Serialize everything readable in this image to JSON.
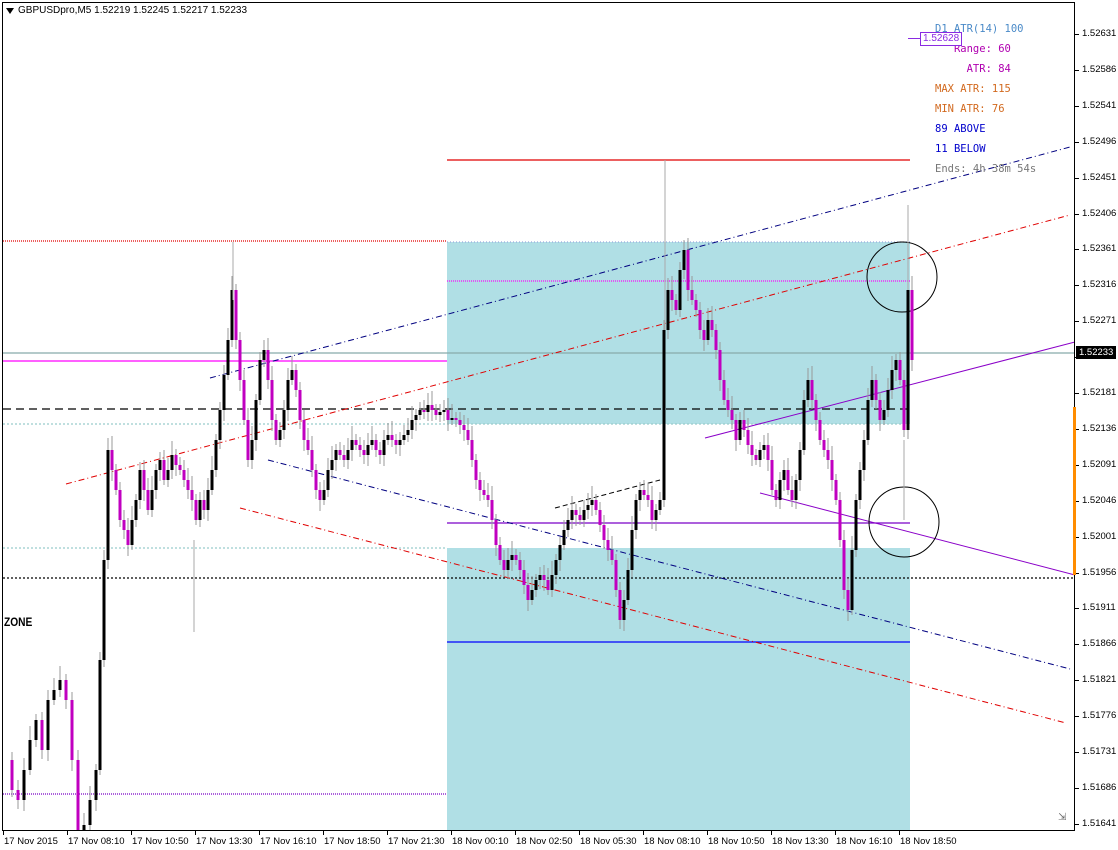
{
  "header": {
    "symbol_line": "GBPUSDpro,M5  1.52219 1.52245 1.52217 1.52233"
  },
  "info_panel": [
    {
      "text": "D1 ATR(14) 100",
      "color": "#4a8ac8"
    },
    {
      "text": "   Range: 60",
      "color": "#b000b0"
    },
    {
      "text": "     ATR: 84",
      "color": "#b000b0"
    },
    {
      "text": "MAX ATR: 115",
      "color": "#d2691e"
    },
    {
      "text": "MIN ATR: 76",
      "color": "#d2691e"
    },
    {
      "text": "89 ABOVE",
      "color": "#0000cc"
    },
    {
      "text": "11 BELOW",
      "color": "#0000cc"
    },
    {
      "text": "Ends: 4h 38m 54s",
      "color": "#777777"
    }
  ],
  "price_tag": "1.52628",
  "current_price": "1.52233",
  "zone_label": "ZONE",
  "y_axis": {
    "labels": [
      "1.52631",
      "1.52586",
      "1.52541",
      "1.52496",
      "1.52451",
      "1.52406",
      "1.52361",
      "1.52316",
      "1.52271",
      "1.52226",
      "1.52181",
      "1.52136",
      "1.52091",
      "1.52046",
      "1.52001",
      "1.51956",
      "1.51911",
      "1.51866",
      "1.51821",
      "1.51776",
      "1.51731",
      "1.51686",
      "1.51641"
    ]
  },
  "x_axis": {
    "labels": [
      "17 Nov 2015",
      "17 Nov 08:10",
      "17 Nov 10:50",
      "17 Nov 13:30",
      "17 Nov 16:10",
      "17 Nov 18:50",
      "17 Nov 21:30",
      "18 Nov 00:10",
      "18 Nov 02:50",
      "18 Nov 05:30",
      "18 Nov 08:10",
      "18 Nov 10:50",
      "18 Nov 13:30",
      "18 Nov 16:10",
      "18 Nov 18:50"
    ]
  },
  "colors": {
    "zone_fill": "#b0dfe5",
    "candle": "#000000",
    "candle_alt": "#c000c0",
    "magenta_level": "#ff00ff",
    "red_level": "#e00000",
    "blue_level": "#0000ff",
    "purple_level": "#7a00c8"
  },
  "icons": {
    "scroll": "auto-scroll-icon"
  }
}
